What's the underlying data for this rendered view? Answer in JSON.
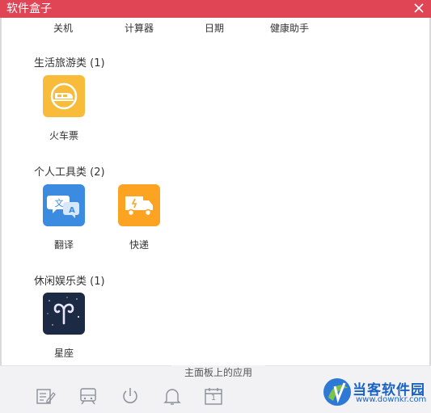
{
  "window": {
    "title": "软件盒子"
  },
  "top_apps": [
    "关机",
    "计算器",
    "日期",
    "健康助手"
  ],
  "categories": [
    {
      "title": "生活旅游类 (1)",
      "apps": [
        {
          "label": "火车票",
          "icon": "train-icon",
          "color": "#f8bb3a"
        }
      ]
    },
    {
      "title": "个人工具类 (2)",
      "apps": [
        {
          "label": "翻译",
          "icon": "translate-icon",
          "color": "#3b8be0"
        },
        {
          "label": "快递",
          "icon": "delivery-truck-icon",
          "color": "#fca321"
        }
      ]
    },
    {
      "title": "休闲娱乐类 (1)",
      "apps": [
        {
          "label": "星座",
          "icon": "aries-icon",
          "color": "#1d2a44"
        }
      ]
    }
  ],
  "bottom": {
    "main_label": "主面板上的应用",
    "icons": [
      "notes-icon",
      "train-ticket-icon",
      "power-icon",
      "bell-icon",
      "calendar-icon"
    ],
    "calendar_day": "1"
  },
  "watermark": {
    "brand": "当客软件园",
    "url": "www.downkr.com"
  },
  "colors": {
    "titlebar": "#e04556",
    "bottombar": "#f2f2f4",
    "icon_stroke": "#8a8f98"
  }
}
